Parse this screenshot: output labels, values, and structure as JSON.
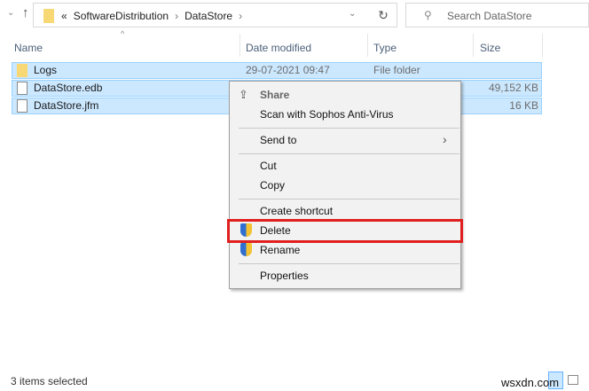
{
  "address": {
    "overflow": "«",
    "crumbs": [
      "SoftwareDistribution",
      "DataStore"
    ]
  },
  "search": {
    "placeholder": "Search DataStore"
  },
  "columns": {
    "name": "Name",
    "date": "Date modified",
    "type": "Type",
    "size": "Size"
  },
  "files": [
    {
      "name": "Logs",
      "date": "29-07-2021 09:47",
      "type": "File folder",
      "size": ""
    },
    {
      "name": "DataStore.edb",
      "date": "",
      "type": "",
      "size": "49,152 KB"
    },
    {
      "name": "DataStore.jfm",
      "date": "",
      "type": "",
      "size": "16 KB"
    }
  ],
  "menu": {
    "share": "Share",
    "scan": "Scan with Sophos Anti-Virus",
    "send_to": "Send to",
    "cut": "Cut",
    "copy": "Copy",
    "create_shortcut": "Create shortcut",
    "delete": "Delete",
    "rename": "Rename",
    "properties": "Properties"
  },
  "status": "3 items selected",
  "watermark": "wsxdn.com",
  "colors": {
    "selection": "#cce8ff",
    "highlight": "#e0201f"
  }
}
